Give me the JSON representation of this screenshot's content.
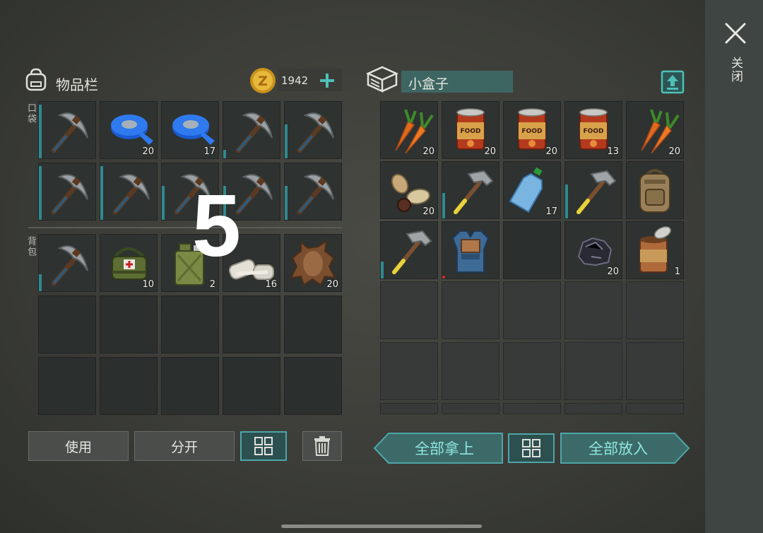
{
  "inventory": {
    "title": "物品栏",
    "coins": "1942",
    "pocket_label": "口袋",
    "backpack_label": "背包",
    "pocket_slots": [
      {
        "icon": "pickaxe-icon",
        "count": "",
        "bar": 0.95
      },
      {
        "icon": "duct-tape-icon",
        "count": "20"
      },
      {
        "icon": "duct-tape-icon",
        "count": "17"
      },
      {
        "icon": "pickaxe-icon",
        "count": "",
        "bar": 0.15
      },
      {
        "icon": "pickaxe-icon",
        "count": "",
        "bar": 0.6
      },
      {
        "icon": "pickaxe-icon",
        "count": "",
        "bar": 0.95
      },
      {
        "icon": "pickaxe-icon",
        "count": "",
        "bar": 0.95
      },
      {
        "icon": "pickaxe-icon",
        "count": "",
        "bar": 0.6
      },
      {
        "icon": "pickaxe-icon",
        "count": "",
        "bar": 0.6
      },
      {
        "icon": "pickaxe-icon",
        "count": "",
        "bar": 0.6
      }
    ],
    "backpack_slots": [
      {
        "icon": "pickaxe-icon",
        "count": "",
        "bar": 0.3
      },
      {
        "icon": "medkit-bag-icon",
        "count": "10"
      },
      {
        "icon": "jerrycan-icon",
        "count": "2"
      },
      {
        "icon": "bandage-icon",
        "count": "16"
      },
      {
        "icon": "animal-hide-icon",
        "count": "20"
      },
      {
        "icon": "",
        "count": ""
      },
      {
        "icon": "",
        "count": ""
      },
      {
        "icon": "",
        "count": ""
      },
      {
        "icon": "",
        "count": ""
      },
      {
        "icon": "",
        "count": ""
      },
      {
        "icon": "",
        "count": ""
      },
      {
        "icon": "",
        "count": ""
      },
      {
        "icon": "",
        "count": ""
      },
      {
        "icon": "",
        "count": ""
      },
      {
        "icon": "",
        "count": ""
      }
    ],
    "use_label": "使用",
    "split_label": "分开"
  },
  "box": {
    "name": "小盒子",
    "slots": [
      {
        "icon": "carrot-icon",
        "count": "20"
      },
      {
        "icon": "canned-food-icon",
        "count": "20"
      },
      {
        "icon": "canned-food-icon",
        "count": "20"
      },
      {
        "icon": "canned-food-icon",
        "count": "13"
      },
      {
        "icon": "carrot-icon",
        "count": "20"
      },
      {
        "icon": "seeds-icon",
        "count": "20"
      },
      {
        "icon": "hammer-icon",
        "count": "",
        "bar": 0.45
      },
      {
        "icon": "water-bottle-icon",
        "count": "17"
      },
      {
        "icon": "hammer-icon",
        "count": "",
        "bar": 0.6
      },
      {
        "icon": "backpack-icon",
        "count": ""
      },
      {
        "icon": "hammer-icon",
        "count": "",
        "bar": 0.3
      },
      {
        "icon": "armor-vest-icon",
        "count": "",
        "bar_red": 0.05
      },
      {
        "icon": "",
        "count": ""
      },
      {
        "icon": "coal-icon",
        "count": "20"
      },
      {
        "icon": "open-can-icon",
        "count": "1"
      }
    ],
    "take_all_label": "全部拿上",
    "put_all_label": "全部放入"
  },
  "overlay_number": "5",
  "close_label": "关闭",
  "colors": {
    "accent": "#4ea6a8",
    "durability": "#2f8a91",
    "slot": "#2e3230"
  }
}
